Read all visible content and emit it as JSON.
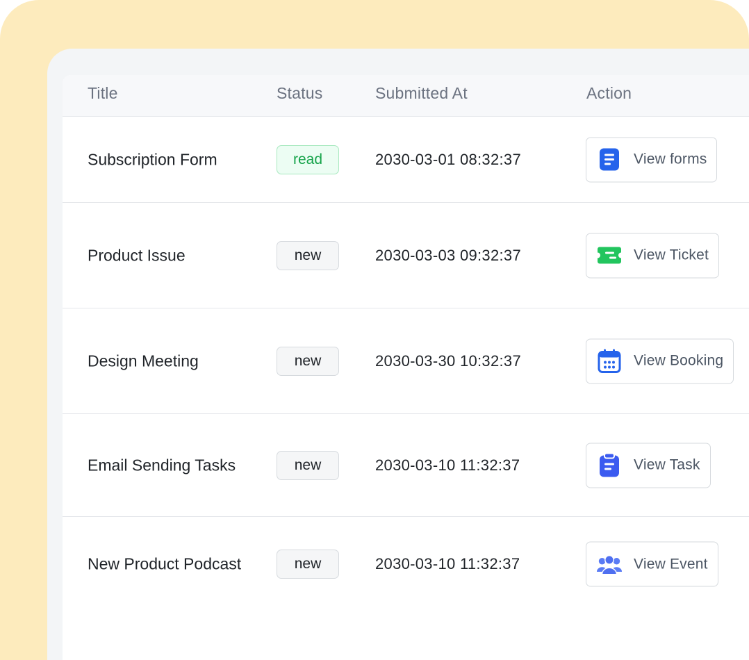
{
  "table": {
    "headers": {
      "title": "Title",
      "status": "Status",
      "submitted_at": "Submitted At",
      "action": "Action"
    },
    "rows": [
      {
        "title": "Subscription Form",
        "status": "read",
        "submitted_at": "2030-03-01 08:32:37",
        "action_label": "View forms",
        "action_icon": "document-icon"
      },
      {
        "title": "Product Issue",
        "status": "new",
        "submitted_at": "2030-03-03 09:32:37",
        "action_label": "View Ticket",
        "action_icon": "ticket-icon"
      },
      {
        "title": "Design Meeting",
        "status": "new",
        "submitted_at": "2030-03-30 10:32:37",
        "action_label": "View Booking",
        "action_icon": "calendar-icon"
      },
      {
        "title": "Email Sending Tasks",
        "status": "new",
        "submitted_at": "2030-03-10 11:32:37",
        "action_label": "View Task",
        "action_icon": "clipboard-icon"
      },
      {
        "title": "New Product Podcast",
        "status": "new",
        "submitted_at": "2030-03-10 11:32:37",
        "action_label": "View Event",
        "action_icon": "users-icon"
      }
    ]
  },
  "colors": {
    "backdrop": "#fdebbd",
    "read_badge_text": "#16a34a",
    "icon_blue": "#2563eb",
    "icon_green": "#22c55e"
  }
}
